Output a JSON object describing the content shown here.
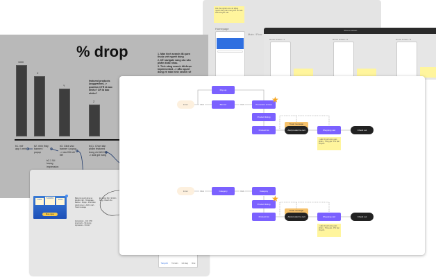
{
  "research_board": {
    "sticky": "Ghi chú nghiên cứu về luồng người dùng trên trang chủ và màn hình khuyến mãi",
    "homepage_label": "Homepage",
    "flow_label": "Main / Flow",
    "promo_label": "Promo Detail - plus"
  },
  "promo_board": {
    "title": "Promo screen",
    "screens": [
      "Home screen / 1",
      "Home screen / 2",
      "Home screen / 3"
    ]
  },
  "drop_board": {
    "title": "% drop",
    "bar_labels": [
      "1000",
      "X",
      "Y",
      "Z"
    ],
    "bar_values": [
      1000,
      800,
      620,
      420
    ],
    "featured_note": "featured products (suggestion) -> position CTR là bao nhiêu? CR là bao nhiêu?",
    "reasons": [
      "1. Màn hình search đã quen thuộc với người dùng",
      "2. Dễ navigate sang các sản phẩm khác nhau.",
      "3. Tính năng search đã được implemented. -> dẫn người dùng về màn hình search sẽ"
    ],
    "steps": [
      "b1. mở app / web",
      "b2. nhìn thấy banner / popup",
      "b3. Click vào banner / popup -> vào KM chi tiết",
      "b4.1. Chọn sản phẩm featured trong chi tiết KM -> add giỏ hàng"
    ],
    "impression": "b2.1 Số lượng impression"
  },
  "notes_board": {
    "banner_cta": "Mua ngay",
    "banner_pct": [
      "10%",
      "5.000%",
      "10%"
    ],
    "col1": "Bảng tin người dùng và khuyến mãi: - Homepage - Banner - Popup - Promotion detail screen - Add to cart - Toast message",
    "col2": "Instructions: - CR, CTR từng bước - Số lượng impression - Chi tiết",
    "col3": "Đo lường KM - Số đơn hàng - Doanh thu",
    "nav": [
      "Trang chủ",
      "Tìm kiếm",
      "Giỏ hàng",
      "Khác"
    ]
  },
  "flow": {
    "row1": {
      "enter": "Enter",
      "click1": "Click",
      "popup": "Pop-up",
      "banner": "Banner",
      "click2": "Click",
      "promo": "Promotion screen",
      "listing": "Product listing",
      "list": "Product list",
      "toast": "Toast message",
      "add": "Add product to cart",
      "cart": "Shopping cart",
      "checkout": "Check out",
      "sticky": "- Hiển thị số lượng sản phẩm - Tổng giá - Phí vận chuyển"
    },
    "row2": {
      "enter": "Enter",
      "click1": "Click",
      "category1": "Category",
      "click2": "Click",
      "category2": "Category",
      "listing": "Product listing",
      "list": "Product list",
      "toast": "Toast message",
      "add": "Add product to cart",
      "cart": "Shopping cart",
      "checkout": "Check out",
      "sticky": "- Hiển thị số lượng sản phẩm - Tổng giá - Phí vận chuyển"
    }
  },
  "colors": {
    "accent": "#7b61ff",
    "star": "#f5a623"
  }
}
